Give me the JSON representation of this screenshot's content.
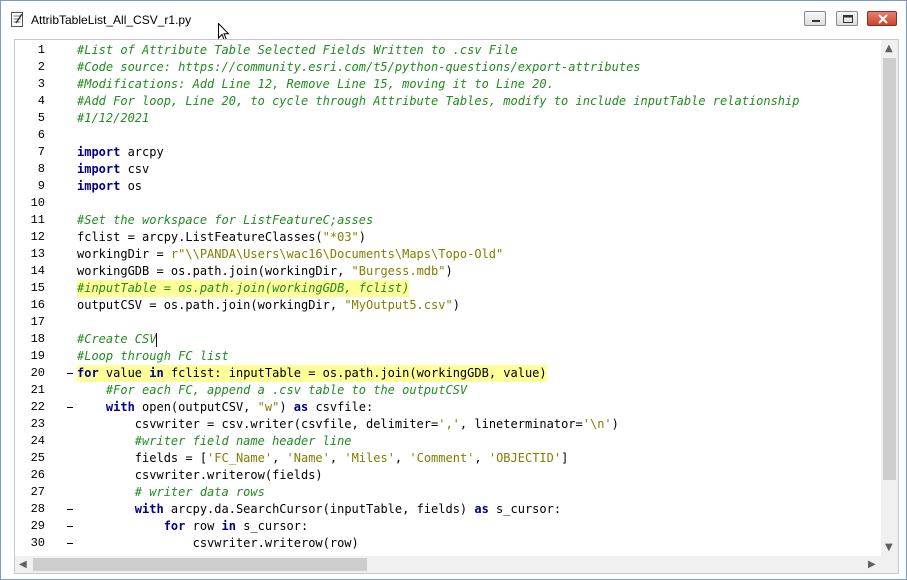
{
  "window": {
    "title": "AttribTableList_All_CSV_r1.py",
    "buttons": [
      "minimize",
      "maximize",
      "close"
    ]
  },
  "editor": {
    "lines": [
      {
        "num": "1",
        "text": "#List of Attribute Table Selected Fields Written to .csv File"
      },
      {
        "num": "2",
        "text": "#Code source: https://community.esri.com/t5/python-questions/export-attributes"
      },
      {
        "num": "3",
        "text": "#Modifications: Add Line 12, Remove Line 15, moving it to Line 20."
      },
      {
        "num": "4",
        "text": "#Add For loop, Line 20, to cycle through Attribute Tables, modify to include inputTable relationship"
      },
      {
        "num": "5",
        "text": "#1/12/2021"
      },
      {
        "num": "6",
        "text": ""
      },
      {
        "num": "7",
        "text": "import arcpy"
      },
      {
        "num": "8",
        "text": "import csv"
      },
      {
        "num": "9",
        "text": "import os"
      },
      {
        "num": "10",
        "text": ""
      },
      {
        "num": "11",
        "text": "#Set the workspace for ListFeatureC;asses"
      },
      {
        "num": "12",
        "text": "fclist = arcpy.ListFeatureClasses(\"*03\")"
      },
      {
        "num": "13",
        "text": "workingDir = r\"\\\\PANDA\\Users\\wac16\\Documents\\Maps\\Topo-Old\""
      },
      {
        "num": "14",
        "text": "workingGDB = os.path.join(workingDir, \"Burgess.mdb\")"
      },
      {
        "num": "15",
        "text": "#inputTable = os.path.join(workingGDB, fclist)"
      },
      {
        "num": "16",
        "text": "outputCSV = os.path.join(workingDir, \"MyOutput5.csv\")"
      },
      {
        "num": "17",
        "text": ""
      },
      {
        "num": "18",
        "text": "#Create CSV"
      },
      {
        "num": "19",
        "text": "#Loop through FC list"
      },
      {
        "num": "20",
        "text": "for value in fclist: inputTable = os.path.join(workingGDB, value)"
      },
      {
        "num": "21",
        "text": "    #For each FC, append a .csv table to the outputCSV"
      },
      {
        "num": "22",
        "text": "    with open(outputCSV, \"w\") as csvfile:"
      },
      {
        "num": "23",
        "text": "        csvwriter = csv.writer(csvfile, delimiter=',', lineterminator='\\n')"
      },
      {
        "num": "24",
        "text": "        #writer field name header line"
      },
      {
        "num": "25",
        "text": "        fields = ['FC_Name', 'Name', 'Miles', 'Comment', 'OBJECTID']"
      },
      {
        "num": "26",
        "text": "        csvwriter.writerow(fields)"
      },
      {
        "num": "27",
        "text": "        # writer data rows"
      },
      {
        "num": "28",
        "text": "        with arcpy.da.SearchCursor(inputTable, fields) as s_cursor:"
      },
      {
        "num": "29",
        "text": "            for row in s_cursor:"
      },
      {
        "num": "30",
        "text": "                csvwriter.writerow(row)"
      }
    ]
  },
  "colors": {
    "comment": "#228b22",
    "keyword": "#00008b",
    "string": "#7f7f00",
    "highlight": "#ffff99"
  }
}
